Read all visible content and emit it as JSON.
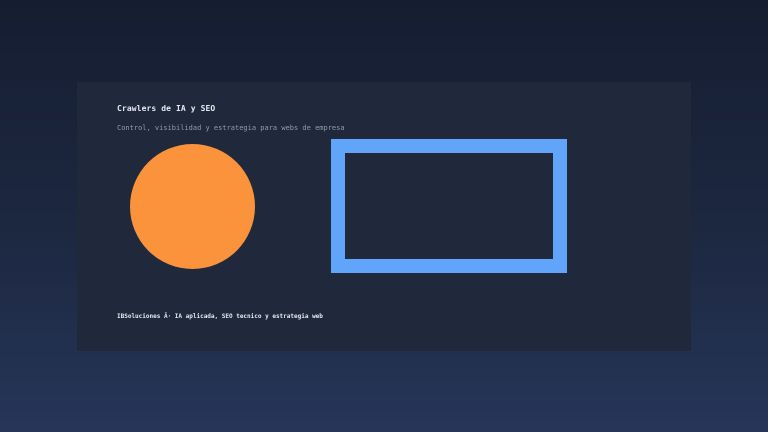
{
  "card": {
    "title": "Crawlers de IA y SEO",
    "subtitle": "Control, visibilidad y estrategia para webs de empresa",
    "footer": "IBSoluciones Â· IA aplicada, SEO tecnico y estrategia web"
  },
  "colors": {
    "background_top": "#151d31",
    "background_bottom": "#263659",
    "card": "#1f293b",
    "circle": "#fb923c",
    "rect_border": "#60a5fa"
  }
}
